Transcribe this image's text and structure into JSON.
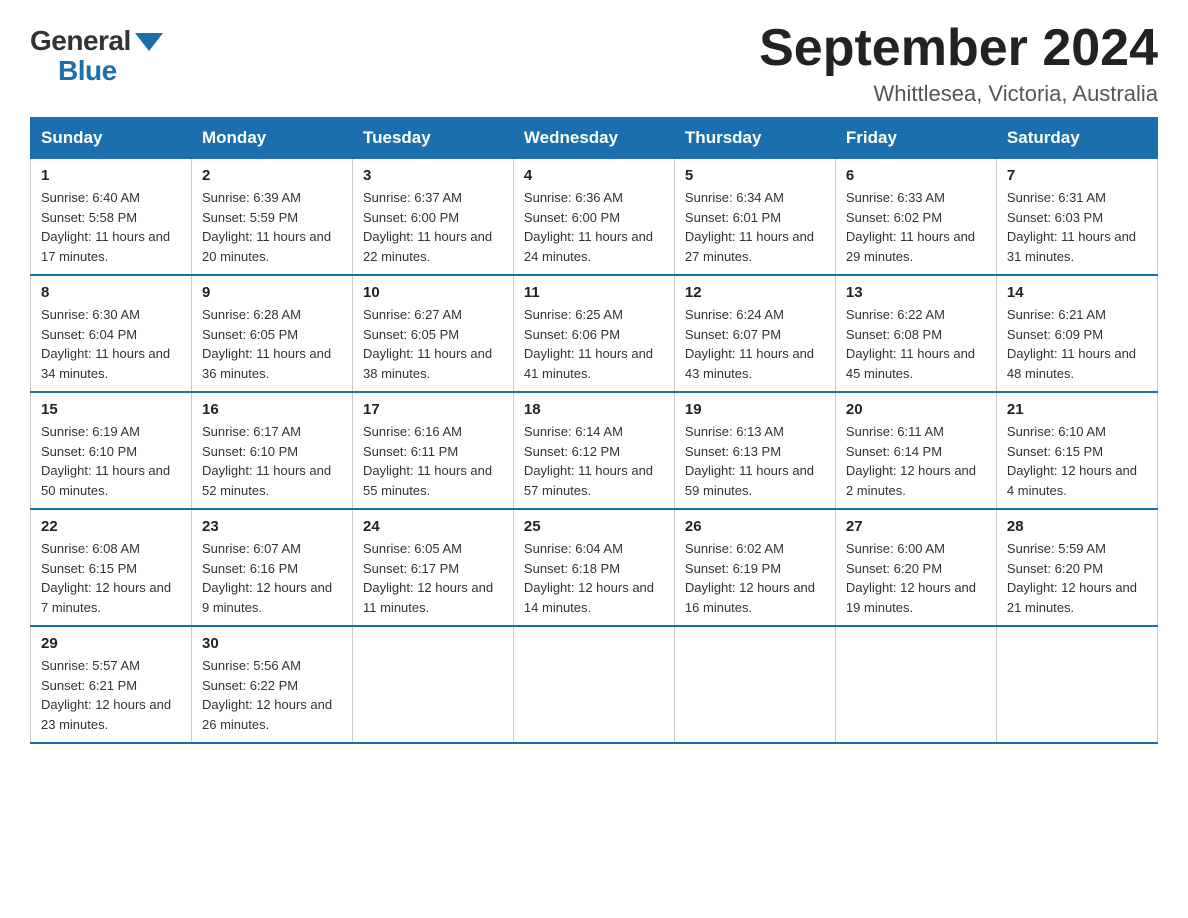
{
  "header": {
    "logo_general": "General",
    "logo_blue": "Blue",
    "title": "September 2024",
    "subtitle": "Whittlesea, Victoria, Australia"
  },
  "days_of_week": [
    "Sunday",
    "Monday",
    "Tuesday",
    "Wednesday",
    "Thursday",
    "Friday",
    "Saturday"
  ],
  "weeks": [
    [
      {
        "day": "1",
        "sunrise": "Sunrise: 6:40 AM",
        "sunset": "Sunset: 5:58 PM",
        "daylight": "Daylight: 11 hours and 17 minutes."
      },
      {
        "day": "2",
        "sunrise": "Sunrise: 6:39 AM",
        "sunset": "Sunset: 5:59 PM",
        "daylight": "Daylight: 11 hours and 20 minutes."
      },
      {
        "day": "3",
        "sunrise": "Sunrise: 6:37 AM",
        "sunset": "Sunset: 6:00 PM",
        "daylight": "Daylight: 11 hours and 22 minutes."
      },
      {
        "day": "4",
        "sunrise": "Sunrise: 6:36 AM",
        "sunset": "Sunset: 6:00 PM",
        "daylight": "Daylight: 11 hours and 24 minutes."
      },
      {
        "day": "5",
        "sunrise": "Sunrise: 6:34 AM",
        "sunset": "Sunset: 6:01 PM",
        "daylight": "Daylight: 11 hours and 27 minutes."
      },
      {
        "day": "6",
        "sunrise": "Sunrise: 6:33 AM",
        "sunset": "Sunset: 6:02 PM",
        "daylight": "Daylight: 11 hours and 29 minutes."
      },
      {
        "day": "7",
        "sunrise": "Sunrise: 6:31 AM",
        "sunset": "Sunset: 6:03 PM",
        "daylight": "Daylight: 11 hours and 31 minutes."
      }
    ],
    [
      {
        "day": "8",
        "sunrise": "Sunrise: 6:30 AM",
        "sunset": "Sunset: 6:04 PM",
        "daylight": "Daylight: 11 hours and 34 minutes."
      },
      {
        "day": "9",
        "sunrise": "Sunrise: 6:28 AM",
        "sunset": "Sunset: 6:05 PM",
        "daylight": "Daylight: 11 hours and 36 minutes."
      },
      {
        "day": "10",
        "sunrise": "Sunrise: 6:27 AM",
        "sunset": "Sunset: 6:05 PM",
        "daylight": "Daylight: 11 hours and 38 minutes."
      },
      {
        "day": "11",
        "sunrise": "Sunrise: 6:25 AM",
        "sunset": "Sunset: 6:06 PM",
        "daylight": "Daylight: 11 hours and 41 minutes."
      },
      {
        "day": "12",
        "sunrise": "Sunrise: 6:24 AM",
        "sunset": "Sunset: 6:07 PM",
        "daylight": "Daylight: 11 hours and 43 minutes."
      },
      {
        "day": "13",
        "sunrise": "Sunrise: 6:22 AM",
        "sunset": "Sunset: 6:08 PM",
        "daylight": "Daylight: 11 hours and 45 minutes."
      },
      {
        "day": "14",
        "sunrise": "Sunrise: 6:21 AM",
        "sunset": "Sunset: 6:09 PM",
        "daylight": "Daylight: 11 hours and 48 minutes."
      }
    ],
    [
      {
        "day": "15",
        "sunrise": "Sunrise: 6:19 AM",
        "sunset": "Sunset: 6:10 PM",
        "daylight": "Daylight: 11 hours and 50 minutes."
      },
      {
        "day": "16",
        "sunrise": "Sunrise: 6:17 AM",
        "sunset": "Sunset: 6:10 PM",
        "daylight": "Daylight: 11 hours and 52 minutes."
      },
      {
        "day": "17",
        "sunrise": "Sunrise: 6:16 AM",
        "sunset": "Sunset: 6:11 PM",
        "daylight": "Daylight: 11 hours and 55 minutes."
      },
      {
        "day": "18",
        "sunrise": "Sunrise: 6:14 AM",
        "sunset": "Sunset: 6:12 PM",
        "daylight": "Daylight: 11 hours and 57 minutes."
      },
      {
        "day": "19",
        "sunrise": "Sunrise: 6:13 AM",
        "sunset": "Sunset: 6:13 PM",
        "daylight": "Daylight: 11 hours and 59 minutes."
      },
      {
        "day": "20",
        "sunrise": "Sunrise: 6:11 AM",
        "sunset": "Sunset: 6:14 PM",
        "daylight": "Daylight: 12 hours and 2 minutes."
      },
      {
        "day": "21",
        "sunrise": "Sunrise: 6:10 AM",
        "sunset": "Sunset: 6:15 PM",
        "daylight": "Daylight: 12 hours and 4 minutes."
      }
    ],
    [
      {
        "day": "22",
        "sunrise": "Sunrise: 6:08 AM",
        "sunset": "Sunset: 6:15 PM",
        "daylight": "Daylight: 12 hours and 7 minutes."
      },
      {
        "day": "23",
        "sunrise": "Sunrise: 6:07 AM",
        "sunset": "Sunset: 6:16 PM",
        "daylight": "Daylight: 12 hours and 9 minutes."
      },
      {
        "day": "24",
        "sunrise": "Sunrise: 6:05 AM",
        "sunset": "Sunset: 6:17 PM",
        "daylight": "Daylight: 12 hours and 11 minutes."
      },
      {
        "day": "25",
        "sunrise": "Sunrise: 6:04 AM",
        "sunset": "Sunset: 6:18 PM",
        "daylight": "Daylight: 12 hours and 14 minutes."
      },
      {
        "day": "26",
        "sunrise": "Sunrise: 6:02 AM",
        "sunset": "Sunset: 6:19 PM",
        "daylight": "Daylight: 12 hours and 16 minutes."
      },
      {
        "day": "27",
        "sunrise": "Sunrise: 6:00 AM",
        "sunset": "Sunset: 6:20 PM",
        "daylight": "Daylight: 12 hours and 19 minutes."
      },
      {
        "day": "28",
        "sunrise": "Sunrise: 5:59 AM",
        "sunset": "Sunset: 6:20 PM",
        "daylight": "Daylight: 12 hours and 21 minutes."
      }
    ],
    [
      {
        "day": "29",
        "sunrise": "Sunrise: 5:57 AM",
        "sunset": "Sunset: 6:21 PM",
        "daylight": "Daylight: 12 hours and 23 minutes."
      },
      {
        "day": "30",
        "sunrise": "Sunrise: 5:56 AM",
        "sunset": "Sunset: 6:22 PM",
        "daylight": "Daylight: 12 hours and 26 minutes."
      },
      null,
      null,
      null,
      null,
      null
    ]
  ]
}
